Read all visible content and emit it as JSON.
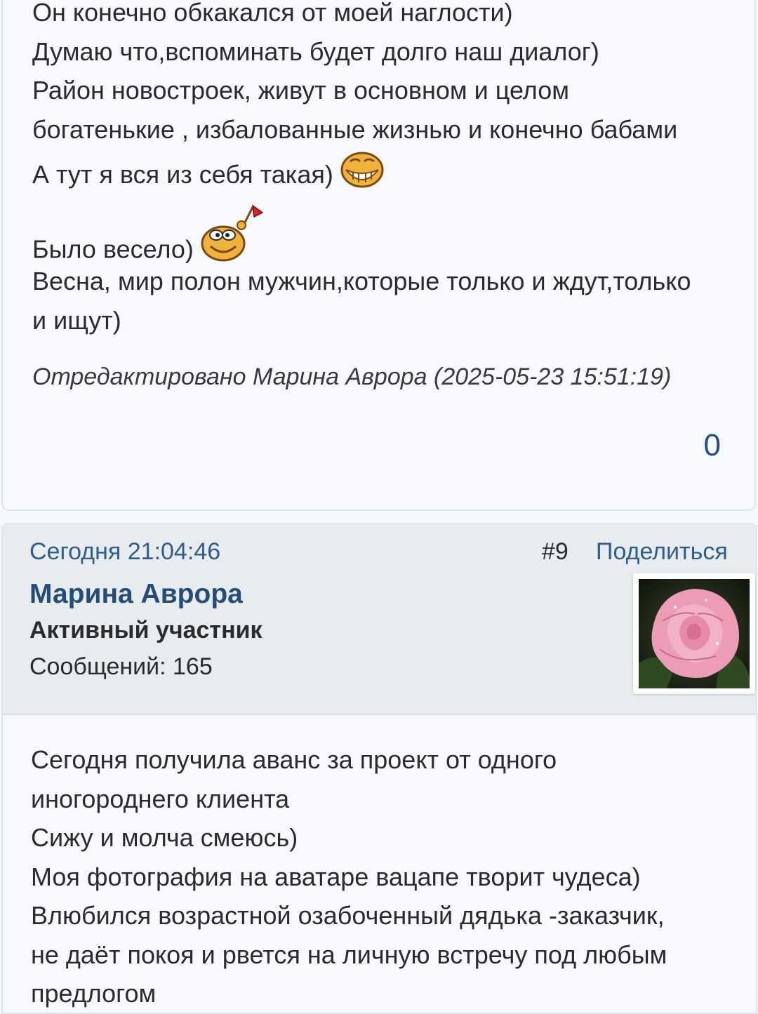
{
  "post_prev": {
    "lines": [
      "Он конечно обкакался от моей наглости)",
      "Думаю что,вспоминать будет долго наш диалог)",
      "Район новостроек, живут в основном и целом",
      "богатенькие , избалованные жизнью и конечно бабами",
      "А тут я вся из себя такая)",
      "Было весело)",
      "Весна, мир полон мужчин,которые только и ждут,только",
      "и ищут)"
    ],
    "edited": "Отредактировано Марина Аврора (2025-05-23 15:51:19)",
    "rating": "0",
    "smileys": [
      "grin-smiley-icon",
      "flag-waving-smiley-icon"
    ]
  },
  "post": {
    "date": "Сегодня 21:04:46",
    "number": "#9",
    "share_label": "Поделиться",
    "author": "Марина Аврора",
    "rank": "Активный участник",
    "messages": "Сообщений: 165",
    "avatar_icon": "rose-avatar",
    "lines": [
      "Сегодня получила аванс за проект от одного",
      "иногороднего клиента",
      "Сижу и молча смеюсь)",
      "Моя фотография на аватаре вацапе творит чудеса)",
      "Влюбился возрастной озабоченный дядька -заказчик,",
      "не даёт покоя и рвется на личную встречу под любым",
      "предлогом"
    ]
  },
  "colors": {
    "link": "#2e5e8e",
    "author": "#244d78",
    "header_bg": "#e8ecef",
    "body_bg": "#f7f9fc"
  }
}
